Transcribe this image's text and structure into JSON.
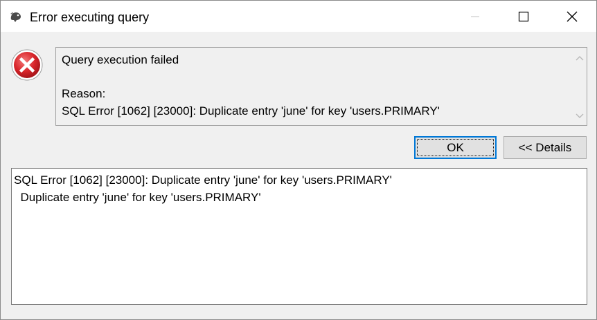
{
  "window": {
    "title": "Error executing query",
    "icons": {
      "app": "beaver-app-icon",
      "status": "error-icon"
    },
    "controls": [
      "minimize",
      "maximize",
      "close"
    ]
  },
  "message": {
    "heading": "Query execution failed",
    "reason_label": "Reason:",
    "reason_text": "SQL Error [1062] [23000]: Duplicate entry 'june' for key 'users.PRIMARY'"
  },
  "buttons": {
    "ok_label": "OK",
    "details_label": "<< Details"
  },
  "details": {
    "line1": "SQL Error [1062] [23000]: Duplicate entry 'june' for key 'users.PRIMARY'",
    "line2": "  Duplicate entry 'june' for key 'users.PRIMARY'"
  },
  "colors": {
    "error_red": "#d9262b",
    "focus_blue": "#0078d7",
    "dialog_bg": "#f0f0f0"
  }
}
